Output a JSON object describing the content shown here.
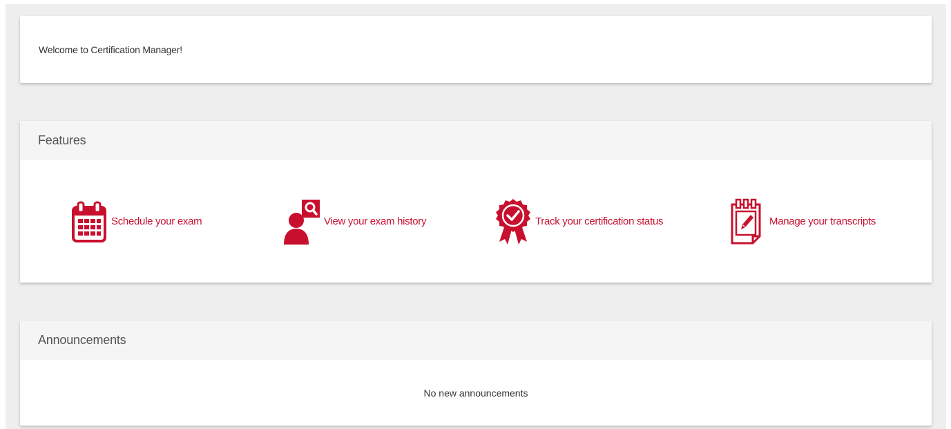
{
  "welcome": {
    "message": "Welcome to Certification Manager!"
  },
  "features": {
    "title": "Features",
    "items": [
      {
        "label": "Schedule your exam",
        "icon": "calendar-icon"
      },
      {
        "label": "View your exam history",
        "icon": "user-search-icon"
      },
      {
        "label": "Track your certification status",
        "icon": "certification-badge-icon"
      },
      {
        "label": "Manage your transcripts",
        "icon": "transcript-edit-icon"
      }
    ]
  },
  "announcements": {
    "title": "Announcements",
    "empty_message": "No new announcements"
  },
  "colors": {
    "accent": "#c8102e",
    "background": "#eeeeee",
    "card_header": "#f5f5f5"
  }
}
